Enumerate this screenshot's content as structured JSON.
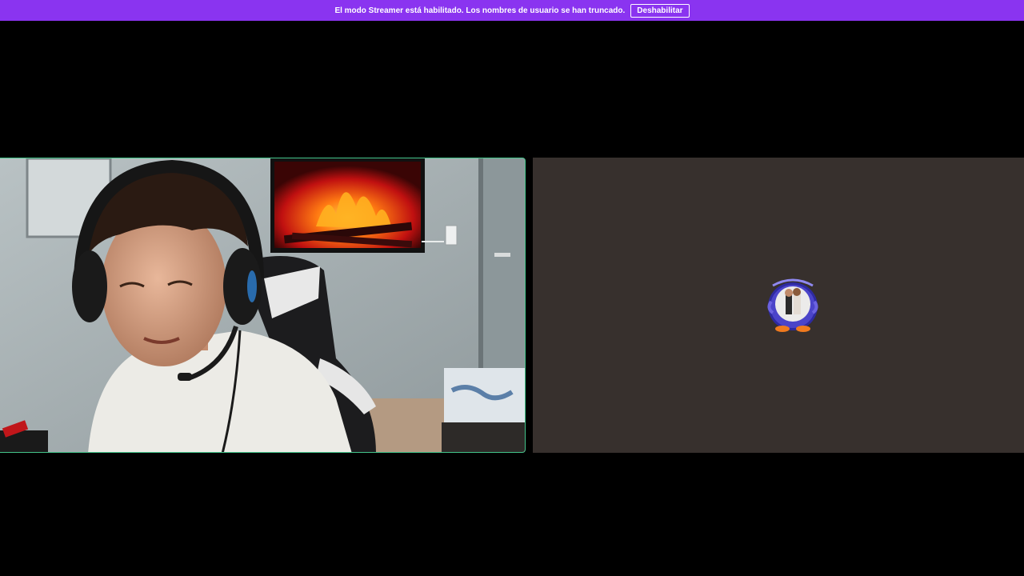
{
  "banner": {
    "message": "El modo Streamer está habilitado. Los nombres de usuario se han truncado.",
    "button_label": "Deshabilitar",
    "background_color": "#8a34f0"
  },
  "call": {
    "participants": [
      {
        "tile": "camera-feed",
        "speaking_border_color": "#43c48a"
      },
      {
        "tile": "avatar",
        "avatar_icon": "penguin-avatar-icon",
        "background_color": "#37302d"
      }
    ]
  }
}
